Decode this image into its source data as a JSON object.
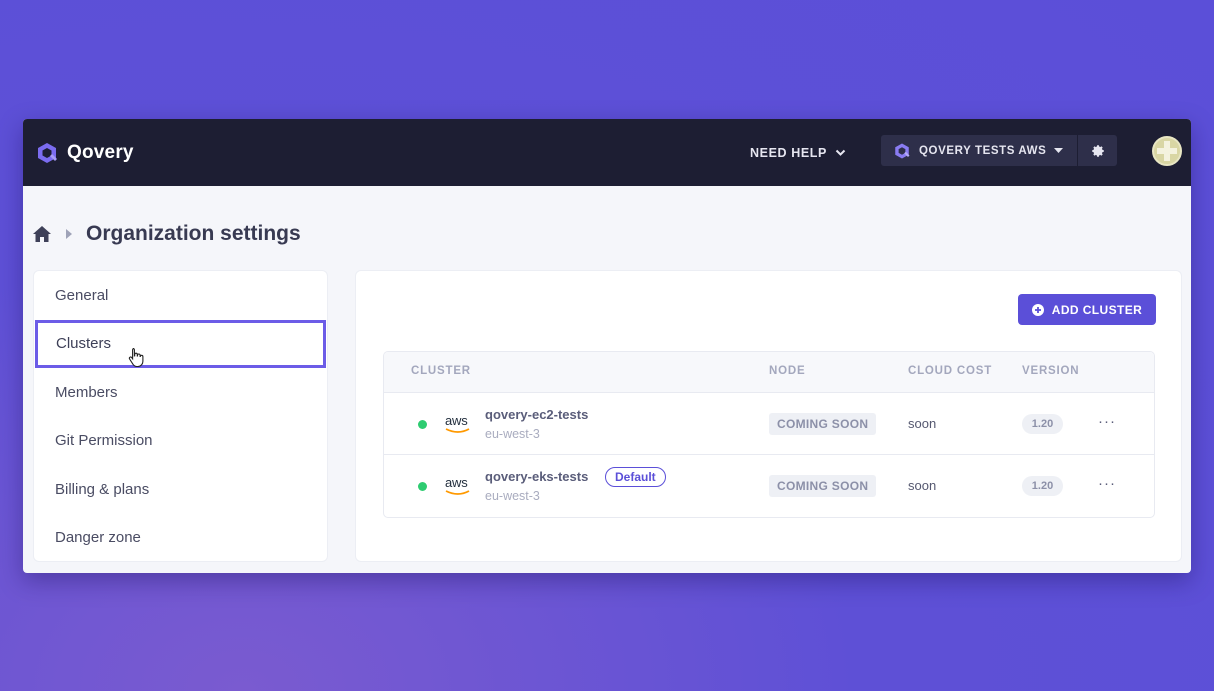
{
  "brand": {
    "name": "Qovery",
    "logo_icon": "qovery-logo-icon"
  },
  "header": {
    "help_label": "NEED HELP",
    "org_name": "QOVERY TESTS AWS",
    "colors": {
      "bar": "#1d1e33",
      "switch": "#2e2f4a"
    }
  },
  "breadcrumb": {
    "home_icon": "home-icon",
    "title": "Organization settings"
  },
  "sidebar": {
    "items": [
      {
        "label": "General"
      },
      {
        "label": "Clusters",
        "active": true
      },
      {
        "label": "Members"
      },
      {
        "label": "Git Permission"
      },
      {
        "label": "Billing & plans"
      },
      {
        "label": "Danger zone"
      }
    ]
  },
  "main": {
    "add_button_label": "ADD CLUSTER",
    "columns": [
      "CLUSTER",
      "NODE",
      "CLOUD COST",
      "VERSION"
    ],
    "rows": [
      {
        "provider": "aws",
        "name": "qovery-ec2-tests",
        "region": "eu-west-3",
        "node": "COMING SOON",
        "cost": "soon",
        "version": "1.20",
        "status": "running",
        "badge": ""
      },
      {
        "provider": "aws",
        "name": "qovery-eks-tests",
        "region": "eu-west-3",
        "node": "COMING SOON",
        "cost": "soon",
        "version": "1.20",
        "status": "running",
        "badge": "Default"
      }
    ],
    "accent_color": "#5b4fd8",
    "status_color": "#2ecc71"
  }
}
